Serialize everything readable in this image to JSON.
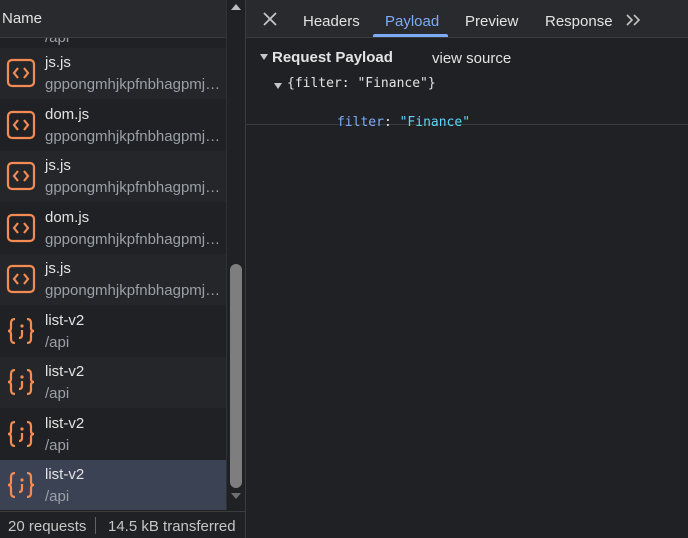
{
  "network_panel": {
    "column_header": "Name",
    "partial_row_sub": "/api",
    "requests": [
      {
        "name": "js.js",
        "sub": "gppongmhjkpfnbhagpmjfkannfbllamg",
        "icon": "script-icon"
      },
      {
        "name": "dom.js",
        "sub": "gppongmhjkpfnbhagpmjfkannfbllamg",
        "icon": "script-icon"
      },
      {
        "name": "js.js",
        "sub": "gppongmhjkpfnbhagpmjfkannfbllamg",
        "icon": "script-icon"
      },
      {
        "name": "dom.js",
        "sub": "gppongmhjkpfnbhagpmjfkannfbllamg",
        "icon": "script-icon"
      },
      {
        "name": "js.js",
        "sub": "gppongmhjkpfnbhagpmjfkannfbllamg",
        "icon": "script-icon"
      },
      {
        "name": "list-v2",
        "sub": "/api",
        "icon": "fetch-icon"
      },
      {
        "name": "list-v2",
        "sub": "/api",
        "icon": "fetch-icon"
      },
      {
        "name": "list-v2",
        "sub": "/api",
        "icon": "fetch-icon"
      },
      {
        "name": "list-v2",
        "sub": "/api",
        "icon": "fetch-icon",
        "selected": true
      }
    ],
    "status": {
      "requests": "20 requests",
      "transferred": "14.5 kB transferred"
    }
  },
  "details": {
    "tabs": [
      "Headers",
      "Payload",
      "Preview",
      "Response"
    ],
    "active_tab": "Payload",
    "payload": {
      "section_title": "Request Payload",
      "view_source": "view source",
      "object_summary": "{filter: \"Finance\"}",
      "property_key": "filter",
      "property_value": "\"Finance\""
    }
  },
  "colors": {
    "accent": "#7cacf8",
    "icon_orange": "#f28b54",
    "string_value": "#5cd5fb"
  }
}
